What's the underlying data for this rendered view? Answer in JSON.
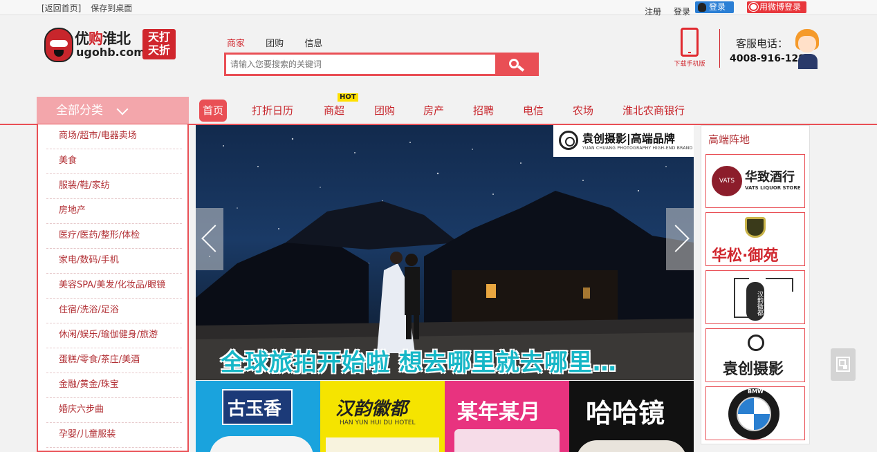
{
  "topbar": {
    "back_home": "[返回首页]",
    "save_desktop": "保存到桌面",
    "register": "注册",
    "login": "登录",
    "qq_login": "登录",
    "weibo_login": "用微博登录"
  },
  "logo": {
    "name_part1": "优",
    "name_part2": "购",
    "name_part3": "淮北",
    "domain": "ugohb.com",
    "badge_line1": "天打",
    "badge_line2": "天折"
  },
  "search": {
    "tabs": [
      "商家",
      "团购",
      "信息"
    ],
    "active_tab": 0,
    "placeholder": "请输入您要搜索的关键词"
  },
  "header_right": {
    "app_label": "下载手机版",
    "service_label": "客服电话：",
    "service_phone": "4008-916-128"
  },
  "nav": {
    "all_categories": "全部分类",
    "items": [
      "首页",
      "打折日历",
      "商超",
      "团购",
      "房产",
      "招聘",
      "电信",
      "农场",
      "淮北农商银行"
    ],
    "active_index": 0,
    "hot_label": "HOT"
  },
  "sidebar": {
    "items": [
      "商场/超市/电器卖场",
      "美食",
      "服装/鞋/家纺",
      "房地产",
      "医疗/医药/整形/体检",
      "家电/数码/手机",
      "美容SPA/美发/化妆品/眼镜",
      "住宿/洗浴/足浴",
      "休闲/娱乐/瑜伽健身/旅游",
      "蛋糕/零食/茶庄/美酒",
      "金融/黄金/珠宝",
      "婚庆六步曲",
      "孕婴/儿童服装"
    ]
  },
  "banner": {
    "brand_title": "袁创摄影|高端品牌",
    "brand_sub": "YUAN CHUANG PHOTOGRAPHY HIGH-END BRAND",
    "slogan": "全球旅拍开始啦 想去哪里就去哪里…"
  },
  "tiles": [
    {
      "title": "古玉香",
      "bg": "#1aa3dd"
    },
    {
      "title": "汉韵徽都",
      "sub": "HAN YUN HUI DU HOTEL",
      "bg": "#f5e400"
    },
    {
      "title": "某年某月",
      "bg": "#e8337f"
    },
    {
      "title": "哈哈镜",
      "bg": "#111111"
    }
  ],
  "right_panel": {
    "title": "高端阵地",
    "brands": [
      {
        "name": "华致酒行",
        "sub": "VATS LIQUOR STORE",
        "icon_text": "VATS"
      },
      {
        "name": "华松·御苑"
      },
      {
        "name": "汉韵徽都"
      },
      {
        "name": "袁创摄影"
      },
      {
        "name": "BMW"
      }
    ]
  },
  "colors": {
    "accent": "#e94f55",
    "dark_red": "#c8262c",
    "category_bg": "#f3a6ab"
  }
}
